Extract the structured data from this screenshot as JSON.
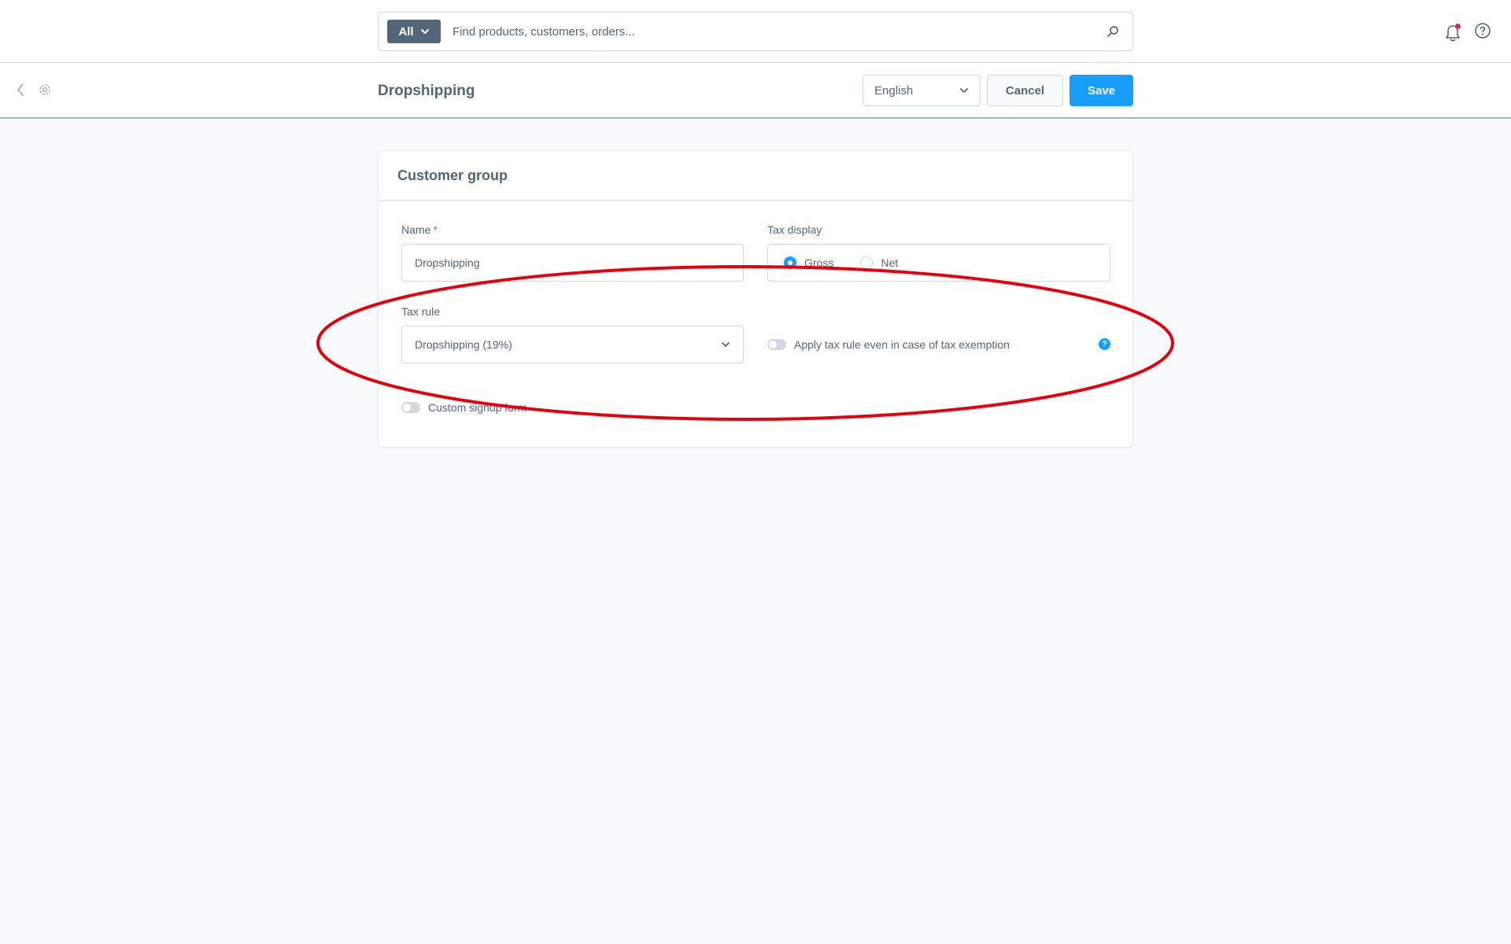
{
  "search": {
    "type_label": "All",
    "placeholder": "Find products, customers, orders..."
  },
  "header": {
    "title": "Dropshipping",
    "language": "English",
    "cancel_label": "Cancel",
    "save_label": "Save"
  },
  "card": {
    "title": "Customer group",
    "name_label": "Name",
    "name_required": "*",
    "name_value": "Dropshipping",
    "tax_display_label": "Tax display",
    "tax_display_options": [
      "Gross",
      "Net"
    ],
    "tax_display_selected": "Gross",
    "tax_rule_label": "Tax rule",
    "tax_rule_value": "Dropshipping (19%)",
    "apply_tax_rule_label": "Apply tax rule even in case of tax exemption",
    "help_icon_glyph": "?",
    "custom_signup_label": "Custom signup form"
  },
  "colors": {
    "primary": "#189eff",
    "text": "#52667a",
    "border": "#d1d9e0",
    "notification_dot": "#de294c",
    "annotation": "#e8000b"
  },
  "icons": [
    "chevron-down-icon",
    "search-icon",
    "bell-icon",
    "help-icon",
    "back-icon",
    "gear-icon"
  ]
}
